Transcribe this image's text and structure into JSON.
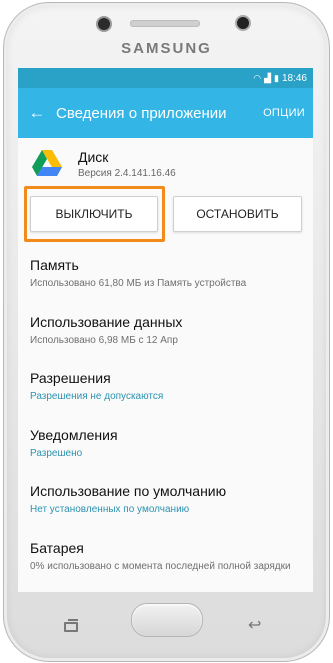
{
  "device": {
    "brand": "SAMSUNG"
  },
  "status_bar": {
    "time": "18:46",
    "wifi_icon": "wifi-icon",
    "signal_icon": "signal-icon",
    "battery_icon": "battery-icon"
  },
  "app_bar": {
    "title": "Сведения о приложении",
    "options_label": "ОПЦИИ",
    "back_icon": "back-arrow-icon"
  },
  "app": {
    "name": "Диск",
    "version": "Версия 2.4.141.16.46",
    "icon": "google-drive-icon"
  },
  "buttons": {
    "disable_label": "ВЫКЛЮЧИТЬ",
    "stop_label": "ОСТАНОВИТЬ"
  },
  "highlight_color": "#f28b1a",
  "accent_color": "#33b5e5",
  "settings": [
    {
      "title": "Память",
      "subtitle": "Использовано 61,80 МБ из Память устройства"
    },
    {
      "title": "Использование данных",
      "subtitle": "Использовано 6,98 МБ с 12 Апр"
    },
    {
      "title": "Разрешения",
      "subtitle": "Разрешения не допускаются"
    },
    {
      "title": "Уведомления",
      "subtitle": "Разрешено"
    },
    {
      "title": "Использование по умолчанию",
      "subtitle": "Нет установленных по умолчанию"
    },
    {
      "title": "Батарея",
      "subtitle": "0% использовано с момента последней полной зарядки"
    }
  ],
  "nav_keys": {
    "recent": "recent-apps-icon",
    "home": "home-button",
    "back": "back-key-icon"
  }
}
